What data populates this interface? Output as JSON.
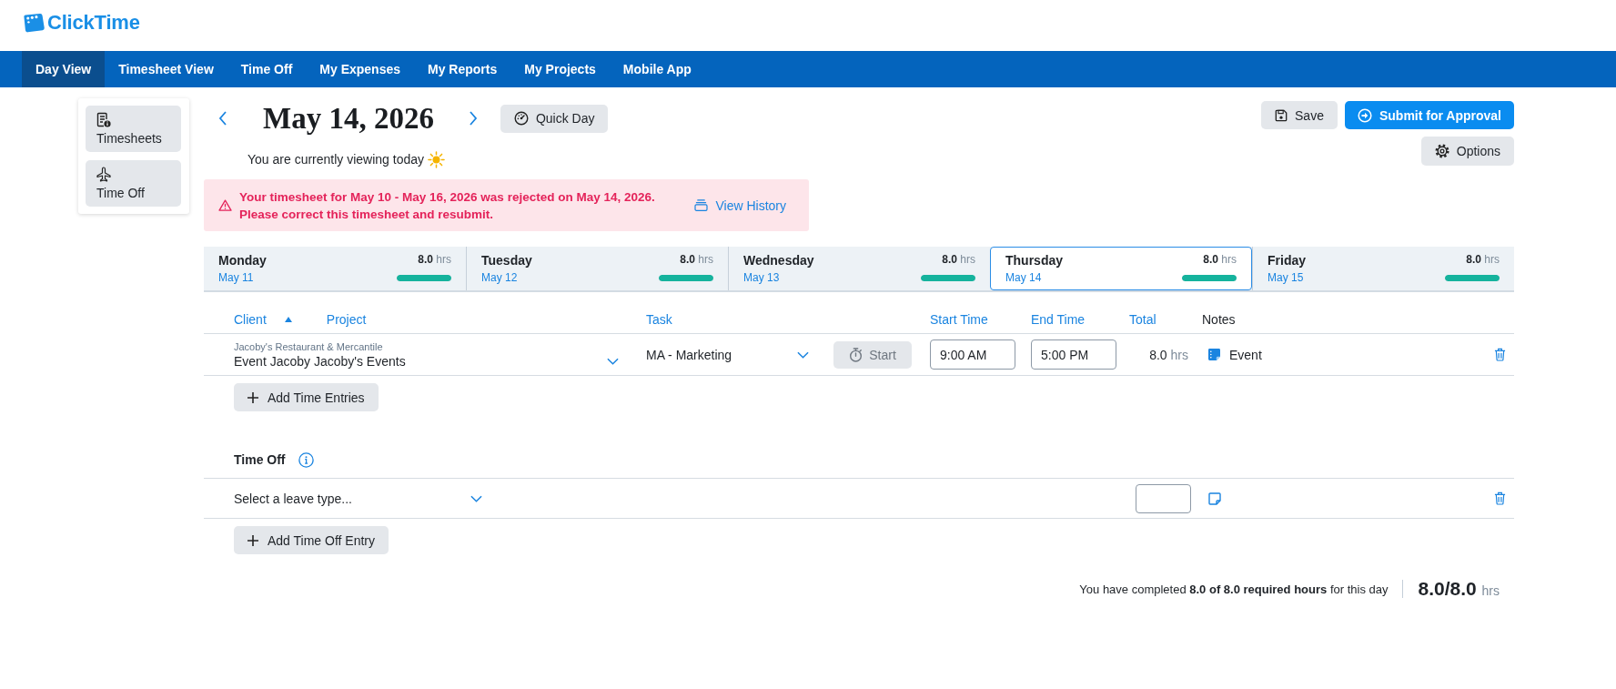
{
  "logo": {
    "text": "ClickTime"
  },
  "nav": [
    {
      "label": "Day View",
      "selected": true
    },
    {
      "label": "Timesheet View",
      "selected": false
    },
    {
      "label": "Time Off",
      "selected": false
    },
    {
      "label": "My Expenses",
      "selected": false
    },
    {
      "label": "My Reports",
      "selected": false
    },
    {
      "label": "My Projects",
      "selected": false
    },
    {
      "label": "Mobile App",
      "selected": false
    }
  ],
  "sidebar": [
    {
      "label": "Timesheets"
    },
    {
      "label": "Time Off"
    }
  ],
  "date_header": {
    "title": "May 14, 2026",
    "subtitle": "You are currently viewing today",
    "quick_day": "Quick Day"
  },
  "actions": {
    "save": "Save",
    "submit": "Submit for Approval",
    "options": "Options"
  },
  "alert": {
    "message": "Your timesheet for May 10 - May 16, 2026 was rejected on May 14, 2026.\nPlease correct this timesheet and resubmit.",
    "link": "View History"
  },
  "days": [
    {
      "name": "Monday",
      "date": "May 11",
      "hours": "8.0",
      "unit": "hrs",
      "level": 1,
      "selected": false
    },
    {
      "name": "Tuesday",
      "date": "May 12",
      "hours": "8.0",
      "unit": "hrs",
      "level": 1,
      "selected": false
    },
    {
      "name": "Wednesday",
      "date": "May 13",
      "hours": "8.0",
      "unit": "hrs",
      "level": 1,
      "selected": false
    },
    {
      "name": "Thursday",
      "date": "May 14",
      "hours": "8.0",
      "unit": "hrs",
      "level": 1,
      "selected": true
    },
    {
      "name": "Friday",
      "date": "May 15",
      "hours": "8.0",
      "unit": "hrs",
      "level": 1,
      "selected": false
    }
  ],
  "entries": {
    "columns": [
      {
        "label": "Client",
        "sortable": true,
        "sorted": true
      },
      {
        "label": "Project",
        "sortable": true,
        "sorted": false
      },
      {
        "label": "Task",
        "sortable": true,
        "sorted": false
      },
      {
        "label": "Start Time",
        "sortable": true,
        "sorted": false
      },
      {
        "label": "End Time",
        "sortable": true,
        "sorted": false
      },
      {
        "label": "Total",
        "sortable": true,
        "sorted": false
      },
      {
        "label": "Notes",
        "sortable": false,
        "sorted": false
      }
    ],
    "rows": [
      {
        "client": "Jacoby's Restaurant & Mercantile",
        "project": "Event Jacoby Jacoby's Events",
        "task": "MA - Marketing",
        "timer": {
          "label": "Start",
          "disabled": true
        },
        "start_time": "9:00 AM",
        "end_time": "5:00 PM",
        "total": "8.0",
        "unit": "hrs",
        "note": "Event"
      }
    ],
    "add_button": "Add Time Entries"
  },
  "time_off": {
    "title": "Time Off",
    "rows": [
      {
        "placeholder": "Select a leave type..."
      }
    ],
    "add_button": "Add Time Off Entry"
  },
  "summary": {
    "text": "You have completed **8.0 of 8.0 required hours** for this day",
    "total": "8.0/8.0",
    "unit": "hrs"
  }
}
